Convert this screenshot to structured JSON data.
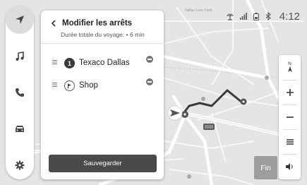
{
  "panel": {
    "title": "Modifier les arrêts",
    "subtitle": "Durée totale du voyage: • 6 min",
    "stops": [
      {
        "badge": "1",
        "name": "Texaco Dallas",
        "icon": "stop-number-badge"
      },
      {
        "name": "Shop",
        "icon": "destination-flag-icon"
      }
    ],
    "save_label": "Sauvegarder"
  },
  "status": {
    "time": "4:12",
    "icons": [
      "gps-signal-icon",
      "cellular-signal-icon",
      "phone-battery-icon",
      "bluetooth-icon"
    ]
  },
  "controls": {
    "compass_letter": "N",
    "end_label": "Fin",
    "icons": [
      "compass-icon",
      "plus-icon",
      "minus-icon",
      "menu-icon",
      "speaker-icon"
    ]
  },
  "rail": {
    "icons": [
      "navigation-arrow-icon",
      "music-note-icon",
      "phone-icon",
      "car-icon",
      "gear-icon"
    ],
    "active": "navigation-arrow-icon"
  },
  "map": {
    "place_label": "Dallas Love Field"
  },
  "colors": {
    "map_background": "#e5e5e5",
    "route": "#3a3a3a",
    "save_button": "#4a4a4a",
    "end_button": "#9d9d9d"
  }
}
